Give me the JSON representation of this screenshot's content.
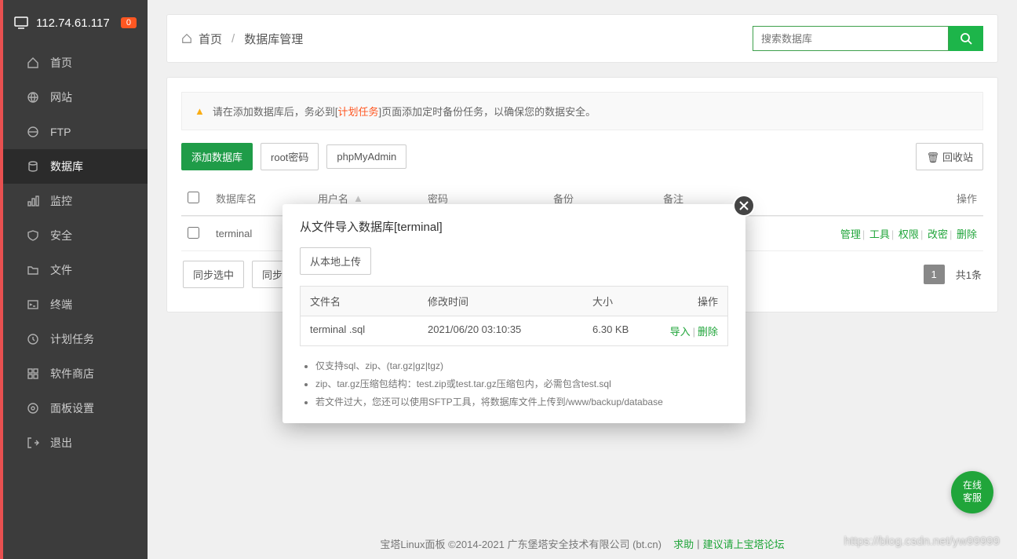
{
  "header": {
    "ip": "112.74.61.117",
    "badge": "0"
  },
  "sidebar": {
    "items": [
      {
        "label": "首页",
        "icon": "home"
      },
      {
        "label": "网站",
        "icon": "globe"
      },
      {
        "label": "FTP",
        "icon": "ftp"
      },
      {
        "label": "数据库",
        "icon": "database",
        "active": true
      },
      {
        "label": "监控",
        "icon": "chart"
      },
      {
        "label": "安全",
        "icon": "shield"
      },
      {
        "label": "文件",
        "icon": "folder"
      },
      {
        "label": "终端",
        "icon": "terminal"
      },
      {
        "label": "计划任务",
        "icon": "clock"
      },
      {
        "label": "软件商店",
        "icon": "grid"
      },
      {
        "label": "面板设置",
        "icon": "gear"
      },
      {
        "label": "退出",
        "icon": "exit"
      }
    ]
  },
  "breadcrumb": {
    "home": "首页",
    "current": "数据库管理"
  },
  "search": {
    "placeholder": "搜索数据库"
  },
  "tip": {
    "prefix": "请在添加数据库后，务必到[",
    "link": "计划任务",
    "suffix": "]页面添加定时备份任务，以确保您的数据安全。"
  },
  "toolbar": {
    "add": "添加数据库",
    "root": "root密码",
    "pma": "phpMyAdmin",
    "recycle": "回收站"
  },
  "table": {
    "headers": {
      "name": "数据库名",
      "user": "用户名",
      "pass": "密码",
      "backup": "备份",
      "note": "备注",
      "op": "操作"
    },
    "row": {
      "name": "terminal",
      "ops": {
        "manage": "管理",
        "tools": "工具",
        "perm": "权限",
        "pw": "改密",
        "del": "删除"
      }
    },
    "bottom": {
      "sync_sel": "同步选中",
      "sync_all_prefix": "同步所",
      "page": "1",
      "total_prefix": "共",
      "total_val": "1",
      "total_suffix": "条"
    }
  },
  "modal": {
    "title": "从文件导入数据库[terminal]",
    "upload": "从本地上传",
    "headers": {
      "name": "文件名",
      "time": "修改时间",
      "size": "大小",
      "op": "操作"
    },
    "row": {
      "name": "terminal .sql",
      "time": "2021/06/20 03:10:35",
      "size": "6.30 KB",
      "import": "导入",
      "del": "删除"
    },
    "tips": [
      "仅支持sql、zip、(tar.gz|gz|tgz)",
      "zip、tar.gz压缩包结构：test.zip或test.tar.gz压缩包内，必需包含test.sql",
      "若文件过大，您还可以使用SFTP工具，将数据库文件上传到/www/backup/database"
    ]
  },
  "footer": {
    "text": "宝塔Linux面板 ©2014-2021 广东堡塔安全技术有限公司 (bt.cn)",
    "help": "求助",
    "sep": "|",
    "suggest": "建议请上宝塔论坛"
  },
  "float_help": "在线\n客服",
  "watermark": "https://blog.csdn.net/yw99999"
}
